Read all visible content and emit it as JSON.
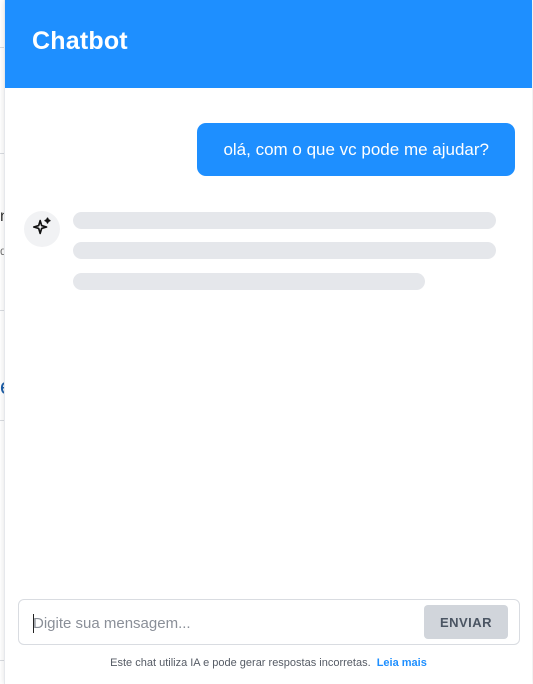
{
  "header": {
    "title": "Chatbot"
  },
  "messages": {
    "user_message": "olá, com o que vc pode me ajudar?",
    "bot_avatar_icon": "sparkles-icon",
    "bot_state": "loading"
  },
  "composer": {
    "placeholder": "Digite sua mensagem...",
    "value": "",
    "send_label": "ENVIAR"
  },
  "footer": {
    "disclaimer_text": "Este chat utiliza IA e pode gerar respostas incorretas.",
    "link_label": "Leia mais"
  },
  "background": {
    "fragment_1": "n",
    "fragment_2": "d",
    "fragment_3": "e"
  },
  "colors": {
    "accent": "#1e8fff",
    "skeleton": "#e5e7eb",
    "send_button_bg": "#d1d5db"
  }
}
